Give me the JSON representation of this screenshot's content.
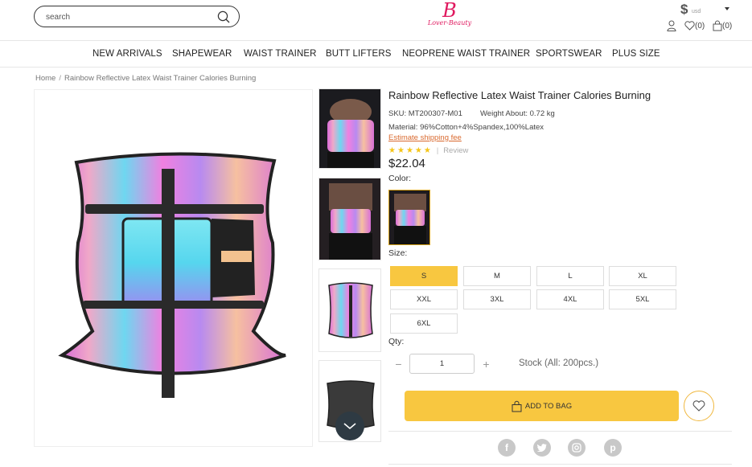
{
  "header": {
    "search_placeholder": "search",
    "logo_mark": "B",
    "logo_text": "Lover-Beauty",
    "currency_symbol": "$",
    "currency_code": "usd",
    "wishlist_count": "(0)",
    "bag_count": "(0)"
  },
  "nav": {
    "items": [
      "NEW ARRIVALS",
      "SHAPEWEAR",
      "WAIST TRAINER",
      "BUTT LIFTERS",
      "NEOPRENE WAIST TRAINER",
      "SPORTSWEAR",
      "PLUS SIZE"
    ]
  },
  "breadcrumb": {
    "home": "Home",
    "current": "Rainbow Reflective Latex Waist Trainer Calories Burning"
  },
  "product": {
    "title": "Rainbow Reflective Latex Waist Trainer Calories Burning",
    "sku": "SKU: MT200307-M01",
    "weight": "Weight About: 0.72 kg",
    "material": "Material: 96%Cotton+4%Spandex,100%Latex",
    "shipping_link": "Estimate shipping fee",
    "rating_stars": 5,
    "review_label": "Review",
    "price": "$22.04",
    "color_label": "Color:",
    "size_label": "Size:",
    "sizes": [
      "S",
      "M",
      "L",
      "XL",
      "XXL",
      "3XL",
      "4XL",
      "5XL",
      "6XL"
    ],
    "selected_size": "S",
    "qty_label": "Qty:",
    "qty_value": "1",
    "stock": "Stock (All: 200pcs.)",
    "add_to_bag": "ADD TO BAG"
  },
  "colors": {
    "accent": "#f8c740",
    "brand": "#e0195f",
    "link": "#d9692e"
  },
  "icons": {
    "social": [
      "facebook-icon",
      "twitter-icon",
      "instagram-icon",
      "pinterest-icon"
    ]
  }
}
